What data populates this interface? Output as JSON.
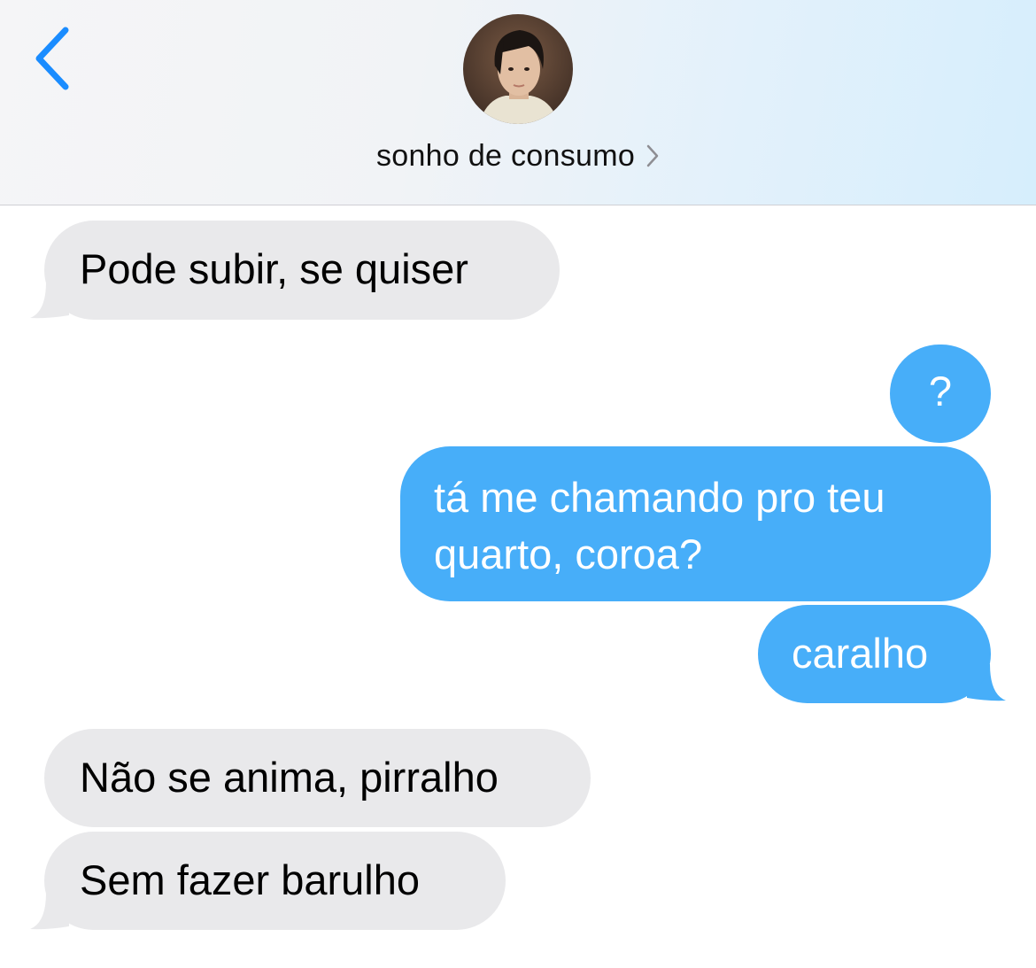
{
  "header": {
    "contact_name": "sonho de consumo",
    "back_icon": "chevron-left-icon",
    "detail_icon": "chevron-right-icon",
    "accent_color": "#1a8cff"
  },
  "messages": [
    {
      "direction": "received",
      "text": "Pode subir, se quiser"
    },
    {
      "direction": "sent",
      "text": "?"
    },
    {
      "direction": "sent",
      "text": "tá me chamando pro teu quarto, coroa?",
      "lines": [
        "tá me chamando pro teu",
        "quarto, coroa?"
      ]
    },
    {
      "direction": "sent",
      "text": "caralho"
    },
    {
      "direction": "received",
      "text": "Não se anima, pirralho"
    },
    {
      "direction": "received",
      "text": "Sem fazer barulho"
    }
  ],
  "colors": {
    "received_bubble": "#e9e9eb",
    "sent_bubble": "#47aef9",
    "received_text": "#000000",
    "sent_text": "#ffffff"
  }
}
